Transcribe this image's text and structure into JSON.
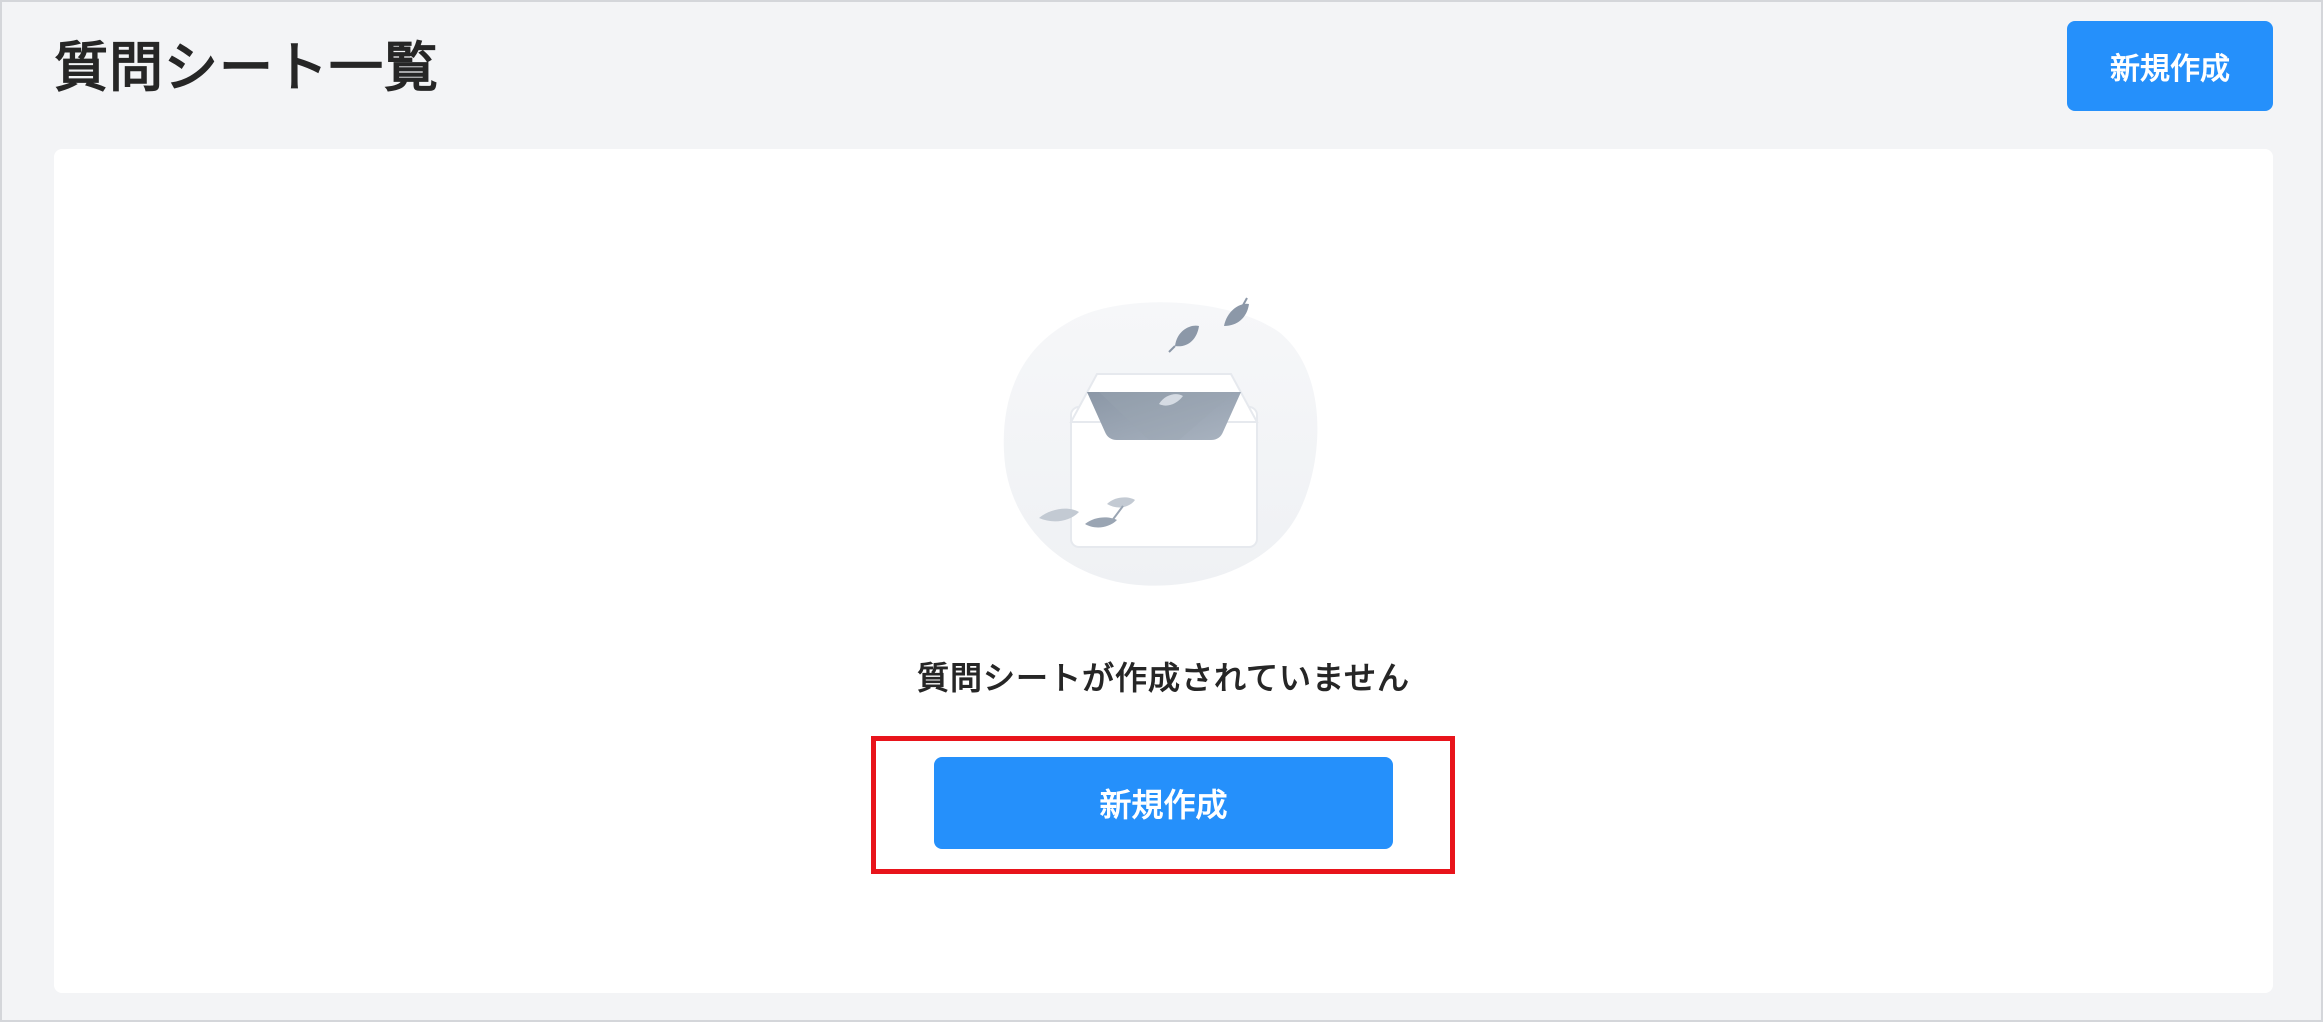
{
  "header": {
    "title": "質問シート一覧",
    "new_button_label": "新規作成"
  },
  "empty_state": {
    "illustration_icon": "empty-inbox-icon",
    "message": "質問シートが作成されていません",
    "new_button_label": "新規作成"
  },
  "colors": {
    "primary": "#2590fb",
    "page_background": "#f3f4f6",
    "card_background": "#ffffff",
    "highlight": "#e8141b"
  }
}
